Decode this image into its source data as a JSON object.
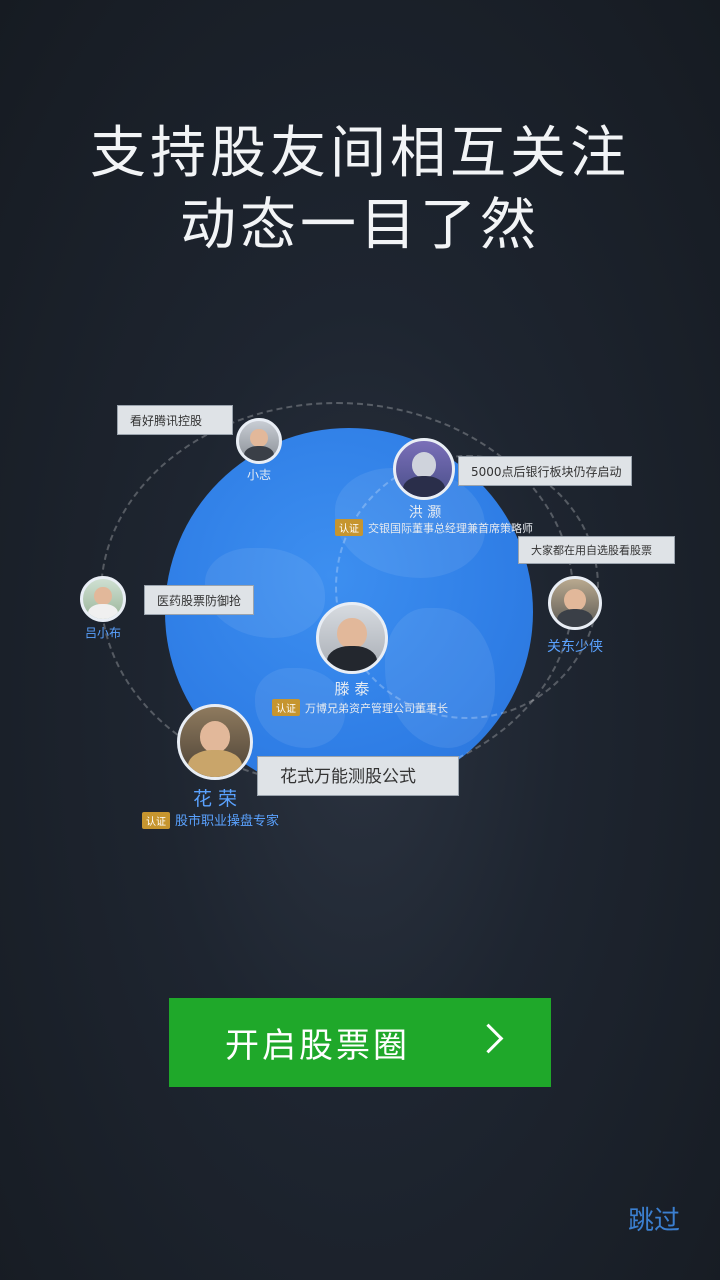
{
  "headline": {
    "line1": "支持股友间相互关注",
    "line2": "动态一目了然"
  },
  "people": {
    "xiaozhi": {
      "name": "小志",
      "bubble": "看好腾讯控股"
    },
    "hongying": {
      "name": "洪 灏",
      "bubble": "5000点后银行板块仍存启动",
      "verify_tag": "认证",
      "verify_text": "交银国际董事总经理兼首席策略师"
    },
    "guandong": {
      "name": "关东少侠",
      "bubble": "大家都在用自选股看股票"
    },
    "lvxiaobu": {
      "name": "吕小布",
      "bubble": "医药股票防御抢"
    },
    "tengtai": {
      "name": "滕 泰",
      "verify_tag": "认证",
      "verify_text": "万博兄弟资产管理公司董事长"
    },
    "huarong": {
      "name": "花 荣",
      "bubble": "花式万能测股公式",
      "verify_tag": "认证",
      "verify_text": "股市职业操盘专家"
    }
  },
  "cta": {
    "label": "开启股票圈"
  },
  "skip": {
    "label": "跳过"
  },
  "colors": {
    "cta": "#1fa82a",
    "globe": "#2f7ee6",
    "skip": "#3b7fd0",
    "verify_tag": "#c6952f"
  }
}
